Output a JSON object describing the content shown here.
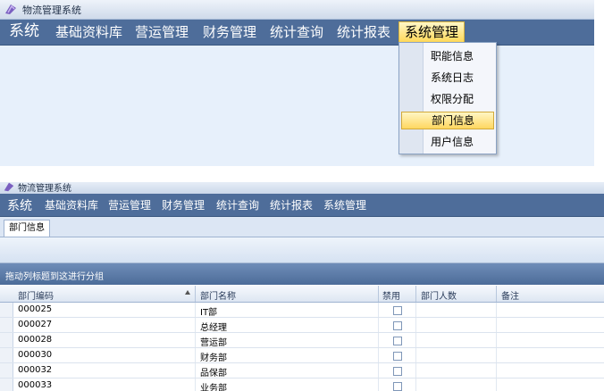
{
  "app_title": "物流管理系统",
  "menu": {
    "items": [
      "系统",
      "基础资料库",
      "营运管理",
      "财务管理",
      "统计查询",
      "统计报表",
      "系统管理"
    ],
    "active_index": 6
  },
  "dropdown": {
    "items": [
      "职能信息",
      "系统日志",
      "权限分配",
      "部门信息",
      "用户信息"
    ],
    "highlighted_index": 3
  },
  "tab": {
    "label": "部门信息"
  },
  "group_hint": "拖动列标题到这进行分组",
  "grid": {
    "columns": [
      "部门编码",
      "部门名称",
      "禁用",
      "部门人数",
      "备注"
    ],
    "sort_column": "部门编码",
    "rows": [
      {
        "code": "000025",
        "name": "IT部",
        "disabled": false,
        "count": "",
        "note": ""
      },
      {
        "code": "000027",
        "name": "总经理",
        "disabled": false,
        "count": "",
        "note": ""
      },
      {
        "code": "000028",
        "name": "营运部",
        "disabled": false,
        "count": "",
        "note": ""
      },
      {
        "code": "000030",
        "name": "财务部",
        "disabled": false,
        "count": "",
        "note": ""
      },
      {
        "code": "000032",
        "name": "品保部",
        "disabled": false,
        "count": "",
        "note": ""
      },
      {
        "code": "000033",
        "name": "业务部",
        "disabled": false,
        "count": "",
        "note": ""
      }
    ]
  },
  "colors": {
    "menubar": "#4e6d9a",
    "active_highlight": "#ffd95a",
    "content_bg": "#e7f0fb"
  }
}
